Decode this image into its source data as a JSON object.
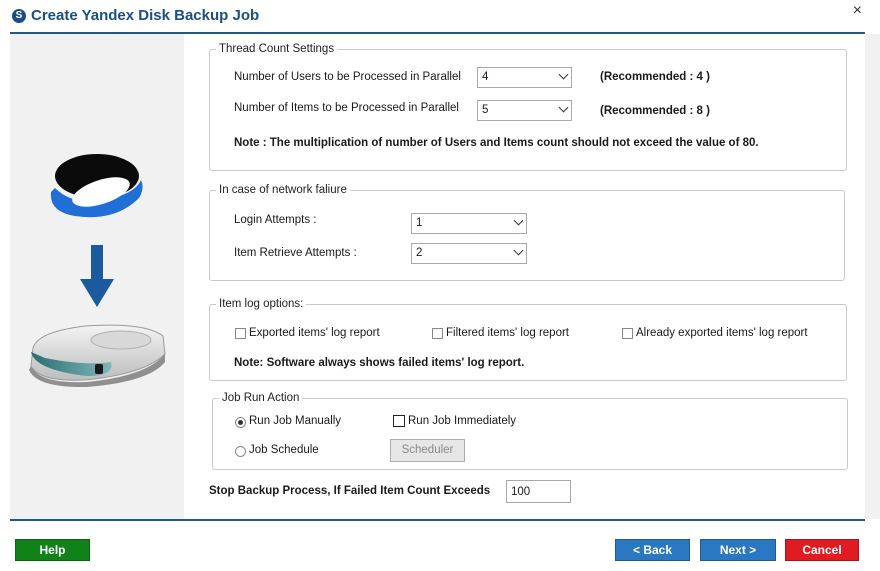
{
  "window": {
    "title": "Create Yandex Disk Backup Job",
    "close_glyph": "×",
    "app_icon_letter": "S"
  },
  "thread_count": {
    "legend": "Thread Count Settings",
    "users_label": "Number of Users to be Processed in Parallel",
    "users_value": "4",
    "users_recommended": "(Recommended : 4 )",
    "items_label": "Number of Items to be Processed in Parallel",
    "items_value": "5",
    "items_recommended": "(Recommended : 8 )",
    "note": "Note : The multiplication of number of Users and Items count should not exceed the value of 80."
  },
  "network_failure": {
    "legend": "In case of network faliure",
    "login_label": "Login Attempts :",
    "login_value": "1",
    "retrieve_label": "Item Retrieve Attempts :",
    "retrieve_value": "2"
  },
  "log_options": {
    "legend": "Item log options:",
    "exported_label": "Exported items' log report",
    "exported_checked": false,
    "filtered_label": "Filtered items' log report",
    "filtered_checked": false,
    "already_label": "Already exported items' log report",
    "already_checked": false,
    "note": "Note: Software always shows failed items' log report."
  },
  "job_run": {
    "legend": "Job Run Action",
    "manual_label": "Run Job Manually",
    "manual_selected": true,
    "immediately_label": "Run Job Immediately",
    "immediately_checked": false,
    "schedule_label": "Job Schedule",
    "schedule_selected": false,
    "scheduler_button": "Scheduler"
  },
  "stop_backup": {
    "label": "Stop Backup Process, If Failed Item Count Exceeds",
    "value": "100"
  },
  "footer": {
    "help": "Help",
    "back": "< Back",
    "next": "Next  >",
    "cancel": "Cancel"
  },
  "colors": {
    "title": "#1b4e86",
    "rule": "#1c5a8a",
    "help_button": "#11821a",
    "nav_button": "#2a78c2",
    "cancel_button": "#e11b22",
    "yandex_cloud": "#1f6fd6"
  },
  "icons": {
    "app": "sysinfo-logo-icon",
    "source": "yandex-disk-cloud-icon",
    "direction": "arrow-down-icon",
    "target": "hard-drive-icon"
  }
}
